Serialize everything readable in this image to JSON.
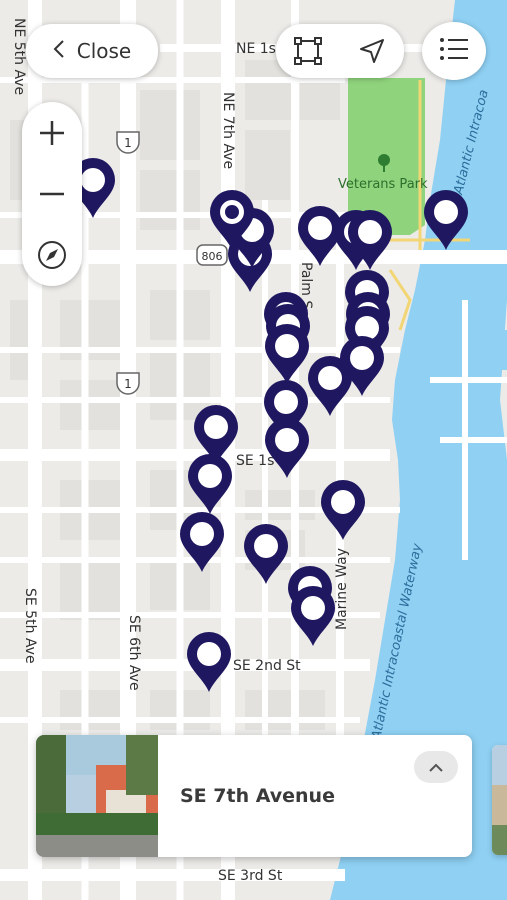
{
  "map": {
    "streets": {
      "ne_1st": "NE 1s",
      "ne_5th_ave": "NE 5th Ave",
      "ne_7th_ave": "NE 7th Ave",
      "palm": "Palm S",
      "se_1st": "SE 1s",
      "se_5th_ave": "SE 5th Ave",
      "se_6th_ave": "SE 6th Ave",
      "marine_way": "Marine Way",
      "se_2nd": "SE 2nd St",
      "se_3rd": "SE 3rd St"
    },
    "shields": {
      "us1_a": "1",
      "us1_b": "1",
      "route806": "806"
    },
    "park": "Veterans Park",
    "waterway_top": "Atlantic Intracoa",
    "waterway_bottom": "Atlantic Intracoastal Waterway",
    "colors": {
      "water": "#8fd0f3",
      "park": "#8fd47c",
      "pin": "#1f1860",
      "road": "#ffffff"
    }
  },
  "controls": {
    "close_label": "Close",
    "icons": [
      "chevron-left-icon",
      "select-area-icon",
      "navigate-arrow-icon",
      "list-icon",
      "plus-icon",
      "minus-icon",
      "compass-icon"
    ]
  },
  "card": {
    "title": "SE 7th Avenue",
    "expand_icon": "chevron-up-icon"
  }
}
